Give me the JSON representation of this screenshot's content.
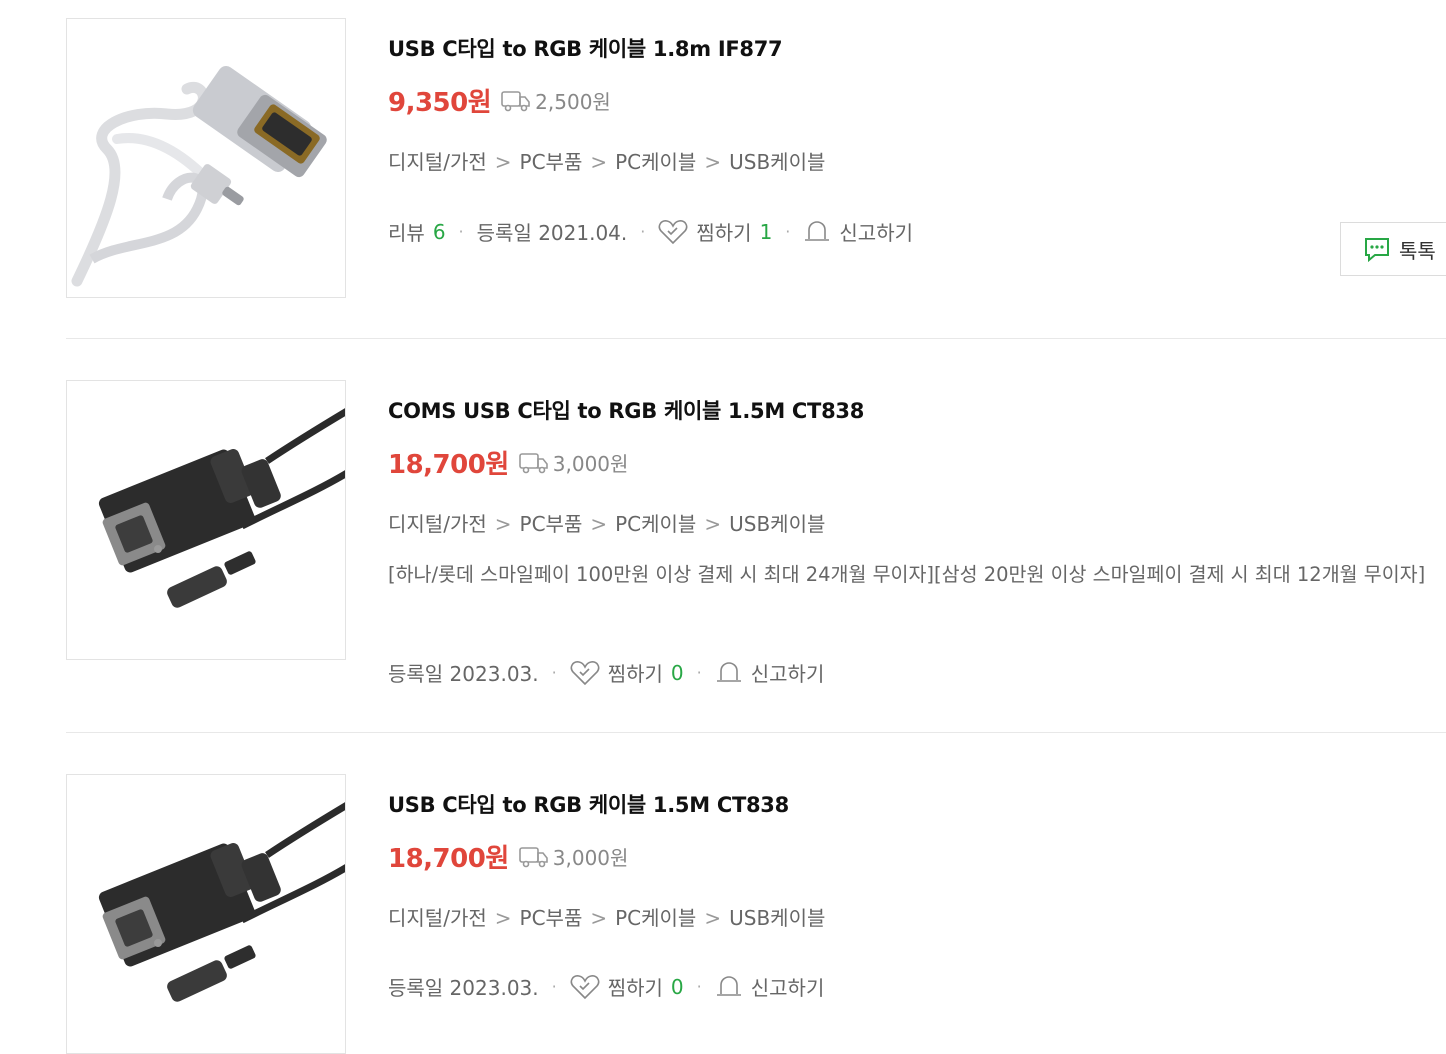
{
  "products": [
    {
      "title": "USB C타입 to RGB 케이블 1.8m IF877",
      "price": "9,350원",
      "shipping": "2,500원",
      "category": [
        "디지털/가전",
        "PC부품",
        "PC케이블",
        "USB케이블"
      ],
      "review_label": "리뷰",
      "review_count": "6",
      "registered": "등록일 2021.04.",
      "wish_label": "찜하기",
      "wish_count": "1",
      "report_label": "신고하기",
      "talk_label": "톡톡",
      "image_color": "light-gray cable"
    },
    {
      "title": "COMS USB C타입 to RGB 케이블 1.5M CT838",
      "price": "18,700원",
      "shipping": "3,000원",
      "category": [
        "디지털/가전",
        "PC부품",
        "PC케이블",
        "USB케이블"
      ],
      "description": "[하나/롯데 스마일페이 100만원 이상 결제 시 최대 24개월 무이자][삼성 20만원 이상 스마일페이 결제 시 최대 12개월 무이자]",
      "registered": "등록일 2023.03.",
      "wish_label": "찜하기",
      "wish_count": "0",
      "report_label": "신고하기",
      "image_color": "black cable"
    },
    {
      "title": "USB C타입 to RGB 케이블 1.5M CT838",
      "price": "18,700원",
      "shipping": "3,000원",
      "category": [
        "디지털/가전",
        "PC부품",
        "PC케이블",
        "USB케이블"
      ],
      "registered": "등록일 2023.03.",
      "wish_label": "찜하기",
      "wish_count": "0",
      "report_label": "신고하기",
      "image_color": "black cable"
    }
  ],
  "category_separator": ">",
  "meta_dot": "·",
  "colors": {
    "price": "#e0463b",
    "count": "#28a745",
    "talk_icon": "#28a745"
  }
}
